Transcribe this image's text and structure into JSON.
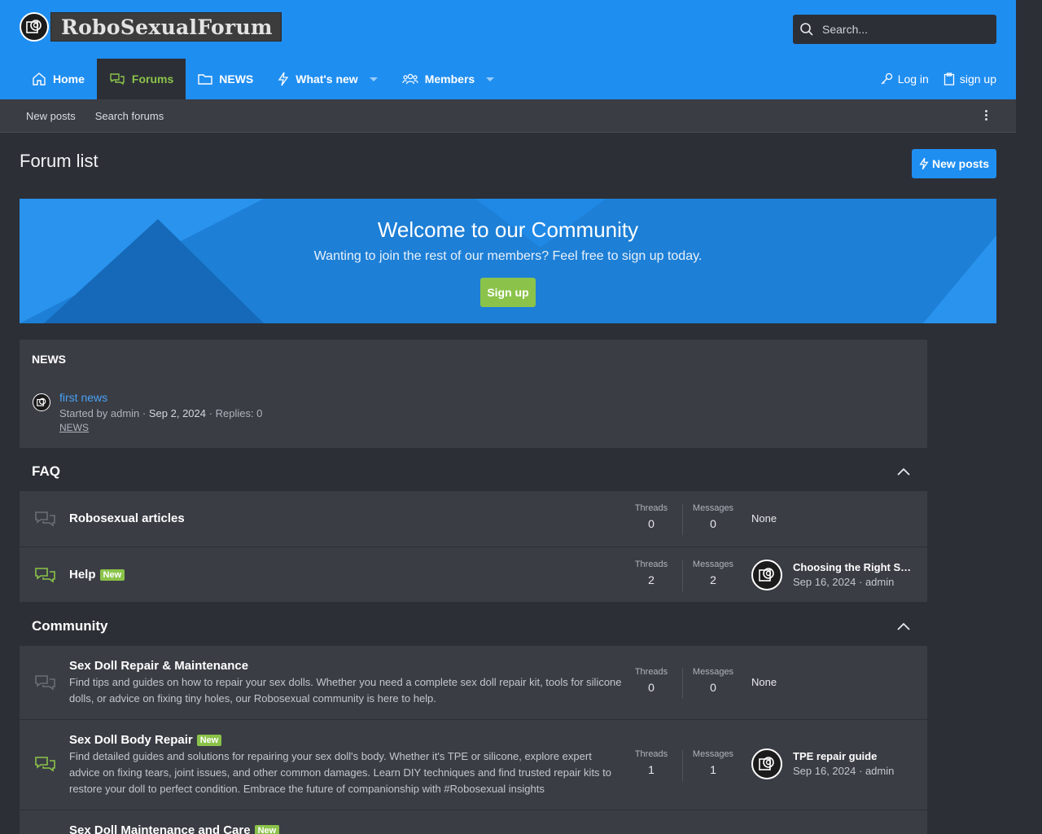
{
  "brand": {
    "name": "RoboSexualForum"
  },
  "search": {
    "placeholder": "Search..."
  },
  "nav": {
    "tabs": [
      {
        "label": "Home",
        "icon": "home-icon"
      },
      {
        "label": "Forums",
        "icon": "comments-icon",
        "active": true
      },
      {
        "label": "NEWS",
        "icon": "folder-icon"
      },
      {
        "label": "What's new",
        "icon": "bolt-icon",
        "dropdown": true
      },
      {
        "label": "Members",
        "icon": "users-icon",
        "dropdown": true
      }
    ],
    "login": "Log in",
    "signup": "sign up"
  },
  "subnav": {
    "items": [
      "New posts",
      "Search forums"
    ]
  },
  "page": {
    "title": "Forum list",
    "new_posts_button": "New posts"
  },
  "banner": {
    "title": "Welcome to our Community",
    "subtitle": "Wanting to join the rest of our members? Feel free to sign up today.",
    "button": "Sign up"
  },
  "news": {
    "heading": "NEWS",
    "item": {
      "title": "first news",
      "started_by": "Started by admin",
      "date": "Sep 2, 2024",
      "replies": "Replies: 0",
      "forum": "NEWS"
    }
  },
  "labels": {
    "threads": "Threads",
    "messages": "Messages",
    "none": "None",
    "new_badge": "New",
    "sep": "·"
  },
  "categories": [
    {
      "title": "FAQ",
      "nodes": [
        {
          "title": "Robosexual articles",
          "is_new": false,
          "threads": "0",
          "messages": "0",
          "last": null
        },
        {
          "title": "Help",
          "is_new": true,
          "threads": "2",
          "messages": "2",
          "last": {
            "title": "Choosing the Right Sex Doll",
            "date": "Sep 16, 2024",
            "user": "admin"
          }
        }
      ]
    },
    {
      "title": "Community",
      "nodes": [
        {
          "title": "Sex Doll Repair & Maintenance",
          "is_new": false,
          "description": "Find tips and guides on how to repair your sex dolls. Whether you need a complete sex doll repair kit, tools for silicone dolls, or advice on fixing tiny holes, our Robosexual community is here to help.",
          "threads": "0",
          "messages": "0",
          "last": null
        },
        {
          "title": "Sex Doll Body Repair",
          "is_new": true,
          "description": "Find detailed guides and solutions for repairing your sex doll's body. Whether it's TPE or silicone, explore expert advice on fixing tears, joint issues, and other common damages. Learn DIY techniques and find trusted repair kits to restore your doll to perfect condition. Embrace the future of companionship with #Robosexual insights",
          "threads": "1",
          "messages": "1",
          "last": {
            "title": "TPE repair guide",
            "date": "Sep 16, 2024",
            "user": "admin"
          }
        },
        {
          "title": "Sex Doll Maintenance and Care",
          "is_new": true
        }
      ]
    }
  ],
  "colors": {
    "header": "#1f8ef1",
    "accent_green": "#8bc34a",
    "body_bg": "#2c2f36",
    "block_bg": "#3a3d44",
    "link": "#49a1f5"
  }
}
